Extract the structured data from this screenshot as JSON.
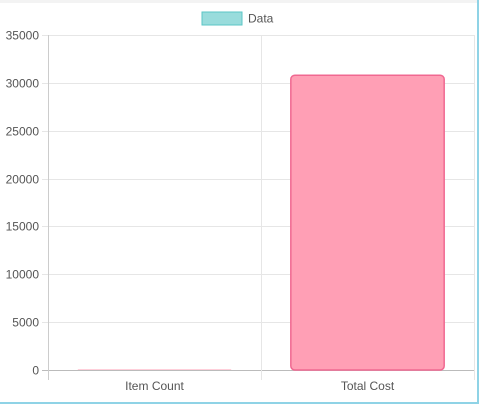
{
  "chart_data": {
    "type": "bar",
    "categories": [
      "Item Count",
      "Total Cost"
    ],
    "series": [
      {
        "name": "Data",
        "values": [
          0,
          30800
        ]
      }
    ],
    "title": "",
    "xlabel": "",
    "ylabel": "",
    "ylim": [
      0,
      35000
    ],
    "yticks": [
      "35000",
      "30000",
      "25000",
      "20000",
      "15000",
      "10000",
      "5000",
      "0"
    ],
    "grid": true,
    "legend": "top",
    "legend_color": "#99dcdc",
    "legend_border": "#5bc6c6",
    "bar_colors": [
      "#ff9fb5",
      "#ff9fb5"
    ],
    "bar_border_colors": [
      "#f06891",
      "#f06891"
    ]
  }
}
